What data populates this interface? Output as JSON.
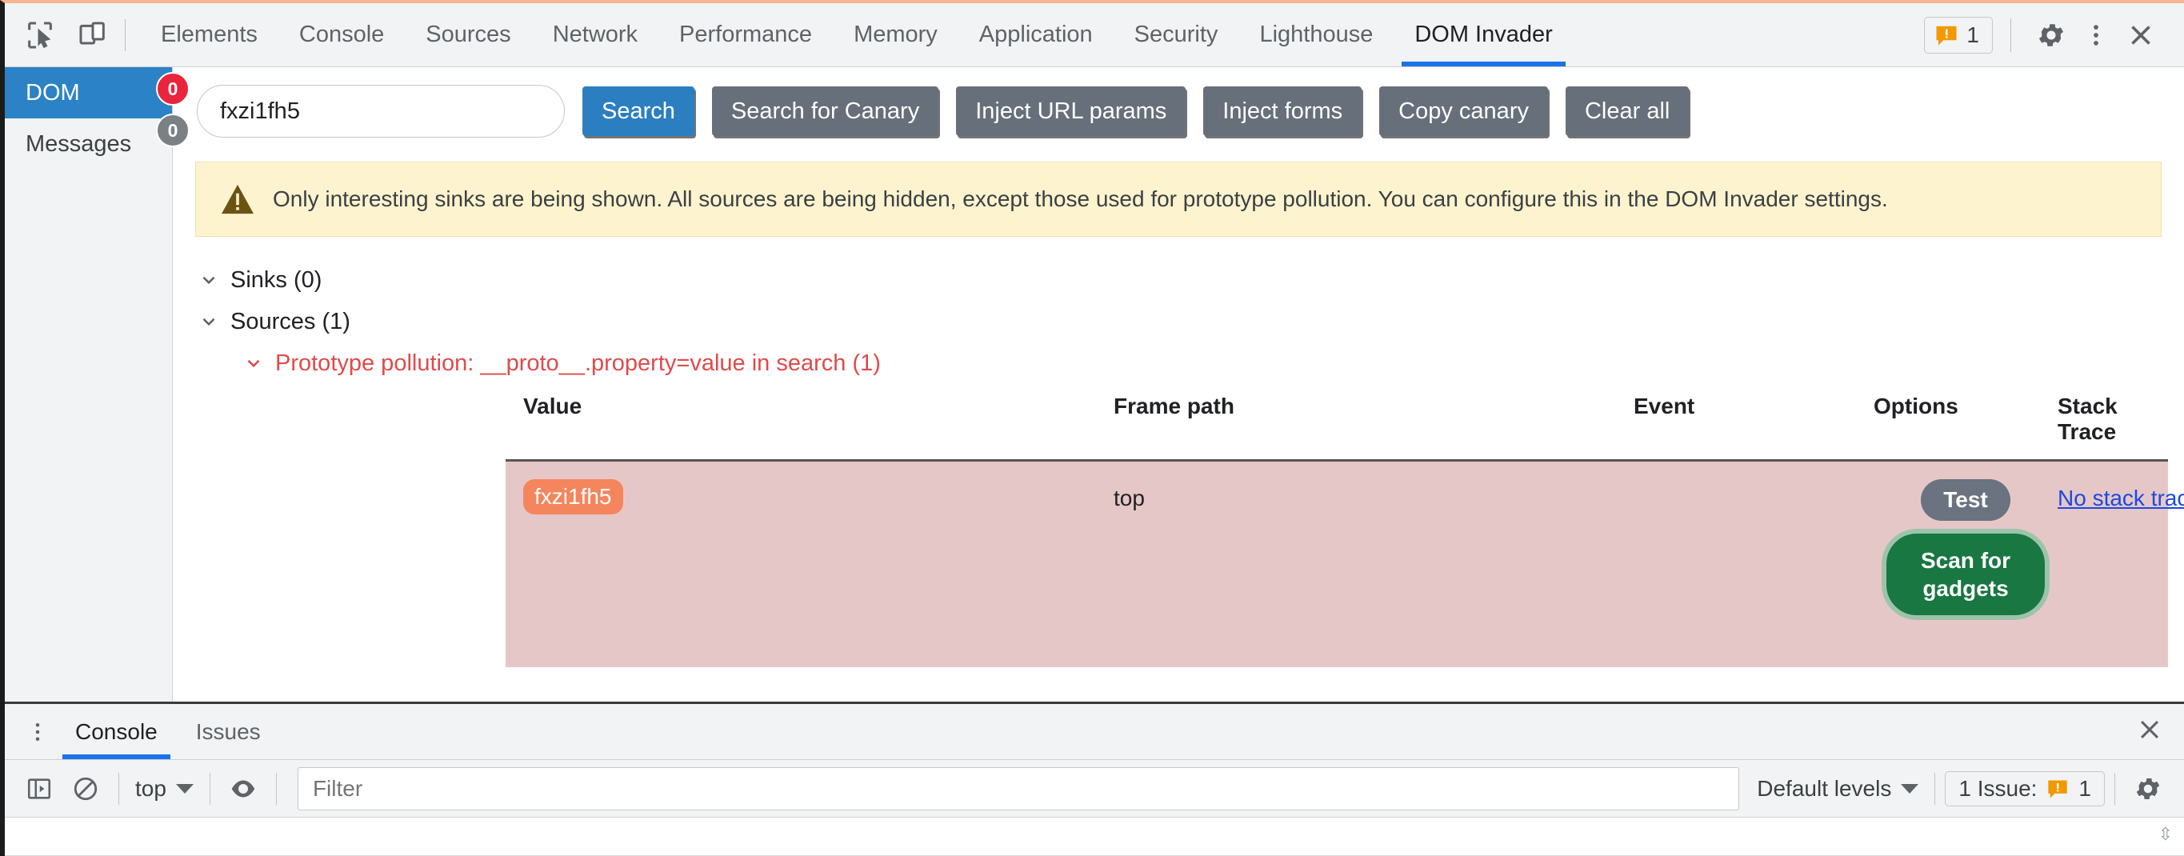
{
  "toolbar": {
    "icons": [
      {
        "name": "inspect-element-icon"
      },
      {
        "name": "device-toolbar-icon"
      }
    ],
    "tabs": [
      {
        "label": "Elements",
        "active": false
      },
      {
        "label": "Console",
        "active": false
      },
      {
        "label": "Sources",
        "active": false
      },
      {
        "label": "Network",
        "active": false
      },
      {
        "label": "Performance",
        "active": false
      },
      {
        "label": "Memory",
        "active": false
      },
      {
        "label": "Application",
        "active": false
      },
      {
        "label": "Security",
        "active": false
      },
      {
        "label": "Lighthouse",
        "active": false
      },
      {
        "label": "DOM Invader",
        "active": true
      }
    ],
    "warning_count": "1",
    "settings_icon": "gear-icon",
    "more_icon": "kebab-menu-icon",
    "close_icon": "close-icon"
  },
  "sidebar": {
    "items": [
      {
        "label": "DOM",
        "badge": "0",
        "badge_color": "#e8253c",
        "active": true
      },
      {
        "label": "Messages",
        "badge": "0",
        "badge_color": "#7b8085",
        "active": false
      }
    ]
  },
  "search": {
    "value": "fxzi1fh5",
    "placeholder": "",
    "buttons": [
      {
        "label": "Search",
        "style": "primary"
      },
      {
        "label": "Search for Canary",
        "style": "secondary"
      },
      {
        "label": "Inject URL params",
        "style": "secondary"
      },
      {
        "label": "Inject forms",
        "style": "secondary"
      },
      {
        "label": "Copy canary",
        "style": "secondary"
      },
      {
        "label": "Clear all",
        "style": "secondary"
      }
    ]
  },
  "banner": {
    "icon": "warning-triangle-icon",
    "text": "Only interesting sinks are being shown. All sources are being hidden, except those used for prototype pollution. You can configure this in the DOM Invader settings."
  },
  "tree": {
    "sinks_label": "Sinks (0)",
    "sources_label": "Sources (1)",
    "source_entry": "Prototype pollution: __proto__.property=value in search (1)"
  },
  "table": {
    "headers": [
      "Value",
      "Frame path",
      "Event",
      "Options",
      "Stack Trace"
    ],
    "rows": [
      {
        "value": "fxzi1fh5",
        "frame_path": "top",
        "event": "",
        "test_label": "Test",
        "scan_label": "Scan for gadgets",
        "stack_trace": "No stack trace a…"
      }
    ]
  },
  "drawer": {
    "tabs": [
      {
        "label": "Console",
        "active": true
      },
      {
        "label": "Issues",
        "active": false
      }
    ],
    "close_icon": "close-icon",
    "console": {
      "sidebar_icon": "console-sidebar-icon",
      "clear_icon": "clear-console-icon",
      "context": "top",
      "eye_icon": "live-expression-icon",
      "filter_placeholder": "Filter",
      "filter_value": "",
      "levels": "Default levels",
      "issues_label": "1 Issue:",
      "issues_count": "1",
      "settings_icon": "gear-icon"
    }
  },
  "colors": {
    "accent_blue": "#1a73e8",
    "active_tab_blue": "#2b82c6",
    "warning_orange": "#f29900",
    "source_red": "#e04a4a",
    "row_pink": "#e6c7c7",
    "canary_orange": "#f5855c",
    "scan_green": "#197741"
  }
}
